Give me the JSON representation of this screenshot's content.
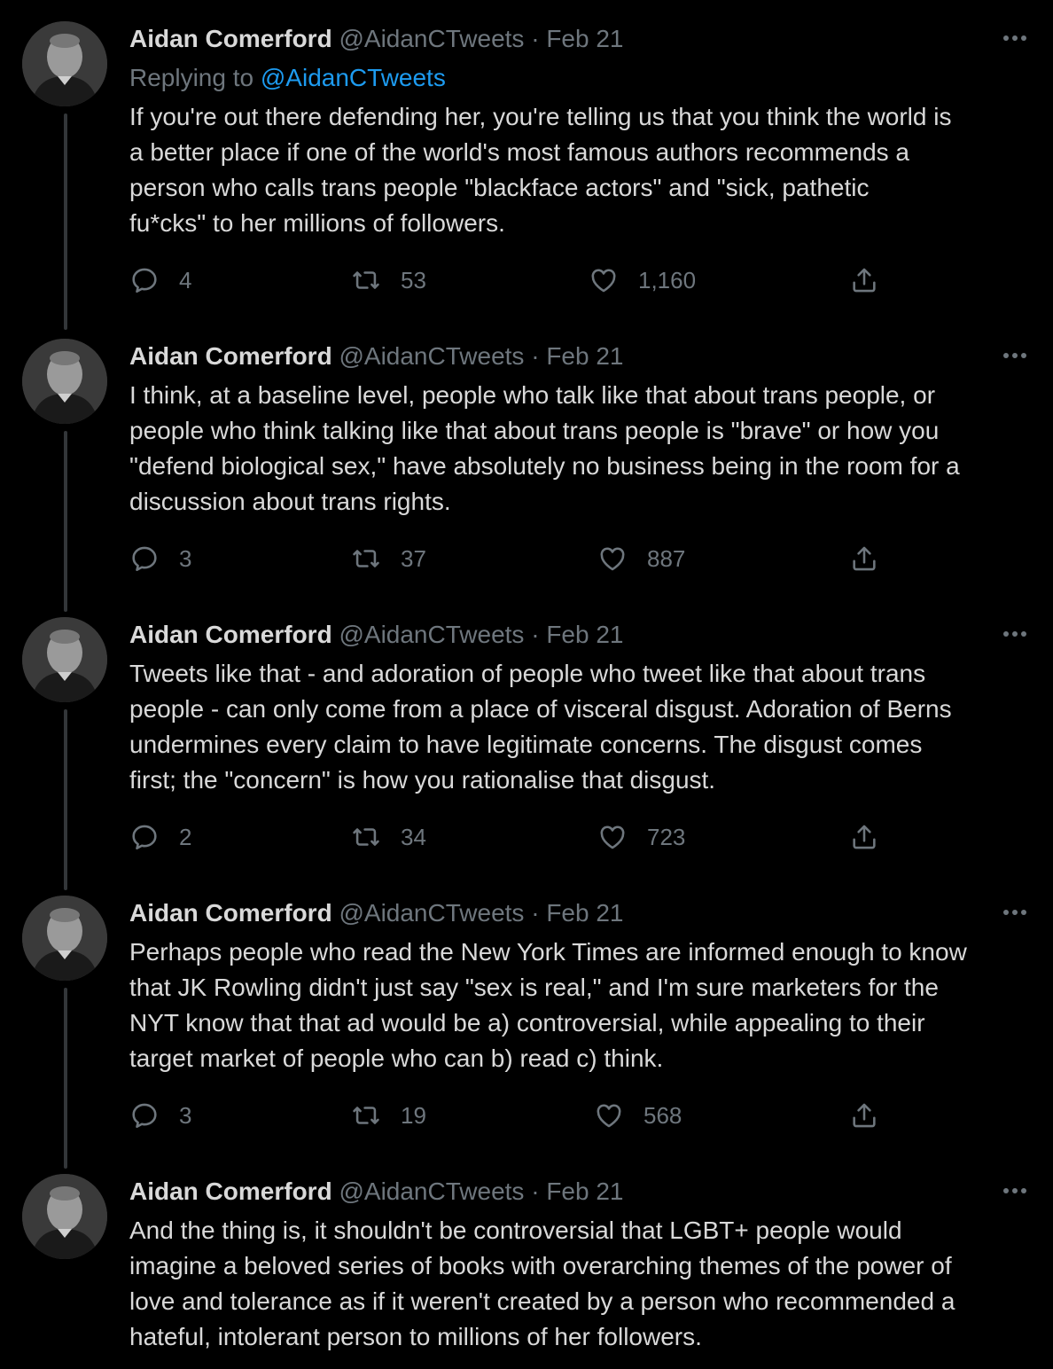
{
  "tweets": [
    {
      "name": "Aidan Comerford",
      "handle": "@AidanCTweets",
      "separator": "·",
      "date": "Feb 21",
      "replying_prefix": "Replying to",
      "replying_handle": "@AidanCTweets",
      "lines": [
        "If you're out there defending her, you're telling us that you think the world is",
        "a better place if one of the world's most famous authors recommends a",
        "person who calls trans people \"blackface actors\" and \"sick, pathetic",
        "fu*cks\" to her millions of followers."
      ],
      "replies": "4",
      "retweets": "53",
      "likes": "1,160"
    },
    {
      "name": "Aidan Comerford",
      "handle": "@AidanCTweets",
      "separator": "·",
      "date": "Feb 21",
      "lines": [
        "I think, at a baseline level, people who talk like that about trans people, or",
        "people who think talking like that about trans people is \"brave\" or how you",
        "\"defend biological sex,\" have absolutely no business being in the room for a",
        "discussion about trans rights."
      ],
      "replies": "3",
      "retweets": "37",
      "likes": "887"
    },
    {
      "name": "Aidan Comerford",
      "handle": "@AidanCTweets",
      "separator": "·",
      "date": "Feb 21",
      "lines": [
        "Tweets like that - and adoration of people who tweet like that about trans",
        "people - can only come from a place of visceral disgust. Adoration of Berns",
        "undermines every claim to have legitimate concerns. The disgust comes",
        "first; the \"concern\" is how you rationalise that disgust."
      ],
      "replies": "2",
      "retweets": "34",
      "likes": "723"
    },
    {
      "name": "Aidan Comerford",
      "handle": "@AidanCTweets",
      "separator": "·",
      "date": "Feb 21",
      "lines": [
        "Perhaps people who read the New York Times are informed enough to know",
        "that JK Rowling didn't just say \"sex is real,\" and I'm sure marketers for the",
        "NYT know that that ad would be a) controversial, while appealing to their",
        "target market of people who can b) read c) think."
      ],
      "replies": "3",
      "retweets": "19",
      "likes": "568"
    },
    {
      "name": "Aidan Comerford",
      "handle": "@AidanCTweets",
      "separator": "·",
      "date": "Feb 21",
      "lines": [
        "And the thing is, it shouldn't be controversial that LGBT+ people would",
        "imagine a beloved series of books with overarching themes of the power of",
        "love and tolerance as if it weren't created by a person who recommended a",
        "hateful, intolerant person to millions of her followers."
      ]
    }
  ],
  "colors": {
    "background": "#000000",
    "text": "#d9d9d9",
    "muted": "#6e767d",
    "link": "#1d9bf0",
    "thread_line": "#333639"
  },
  "icons": [
    "reply-icon",
    "retweet-icon",
    "like-icon",
    "share-icon",
    "more-icon"
  ]
}
